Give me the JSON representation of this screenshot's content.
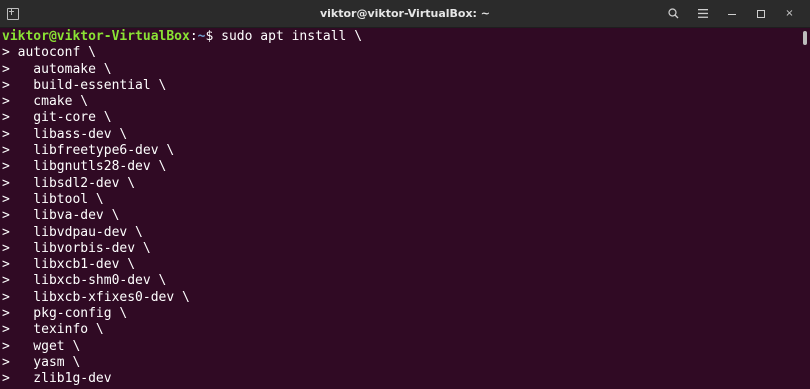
{
  "window": {
    "title": "viktor@viktor-VirtualBox: ~"
  },
  "titlebar": {
    "icons": [
      "new-tab-icon",
      "search-icon",
      "menu-icon",
      "minimize-icon",
      "maximize-icon",
      "close-icon"
    ],
    "close_glyph": "×"
  },
  "terminal": {
    "prompt": {
      "user_host": "viktor@viktor-VirtualBox",
      "separator": ":",
      "path": "~",
      "dollar": "$",
      "command": " sudo apt install \\"
    },
    "lines": [
      "> autoconf \\",
      ">   automake \\",
      ">   build-essential \\",
      ">   cmake \\",
      ">   git-core \\",
      ">   libass-dev \\",
      ">   libfreetype6-dev \\",
      ">   libgnutls28-dev \\",
      ">   libsdl2-dev \\",
      ">   libtool \\",
      ">   libva-dev \\",
      ">   libvdpau-dev \\",
      ">   libvorbis-dev \\",
      ">   libxcb1-dev \\",
      ">   libxcb-shm0-dev \\",
      ">   libxcb-xfixes0-dev \\",
      ">   pkg-config \\",
      ">   texinfo \\",
      ">   wget \\",
      ">   yasm \\",
      ">   zlib1g-dev"
    ]
  },
  "colors": {
    "terminal_bg": "#300a24",
    "titlebar_bg": "#2b2b2b",
    "prompt_user": "#8ae234",
    "prompt_path": "#729fcf",
    "text": "#ffffff"
  }
}
